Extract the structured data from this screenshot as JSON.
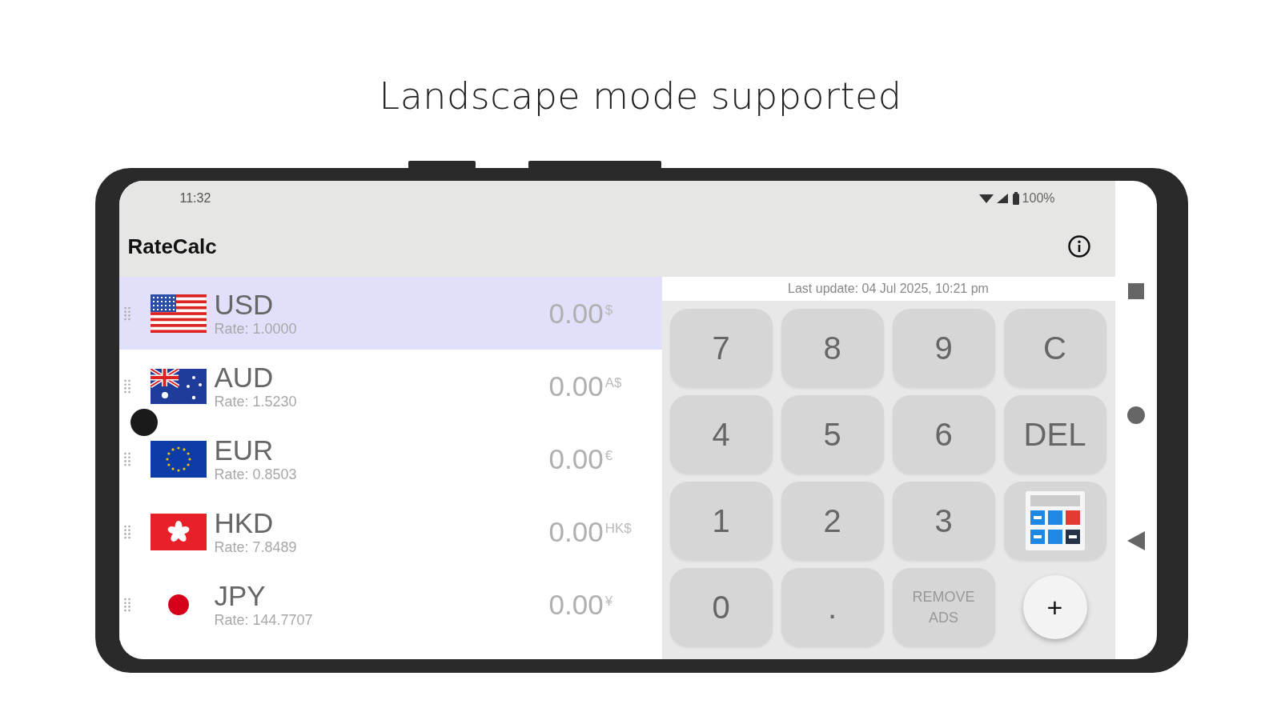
{
  "headline": "Landscape mode supported",
  "status_bar": {
    "time": "11:32",
    "battery": "100%"
  },
  "app_bar": {
    "title": "RateCalc"
  },
  "currencies": [
    {
      "kind": "us",
      "code": "USD",
      "rate": "Rate: 1.0000",
      "amount": "0.00",
      "symbol": "$",
      "selected": true
    },
    {
      "kind": "au",
      "code": "AUD",
      "rate": "Rate: 1.5230",
      "amount": "0.00",
      "symbol": "A$",
      "selected": false
    },
    {
      "kind": "eu",
      "code": "EUR",
      "rate": "Rate: 0.8503",
      "amount": "0.00",
      "symbol": "€",
      "selected": false
    },
    {
      "kind": "hk",
      "code": "HKD",
      "rate": "Rate: 7.8489",
      "amount": "0.00",
      "symbol": "HK$",
      "selected": false
    },
    {
      "kind": "jp",
      "code": "JPY",
      "rate": "Rate: 144.7707",
      "amount": "0.00",
      "symbol": "¥",
      "selected": false
    }
  ],
  "last_update": "Last update: 04 Jul 2025, 10:21 pm",
  "keys": [
    {
      "kind": "key",
      "label": "7"
    },
    {
      "kind": "key",
      "label": "8"
    },
    {
      "kind": "key",
      "label": "9"
    },
    {
      "kind": "key",
      "label": "C"
    },
    {
      "kind": "key",
      "label": "4"
    },
    {
      "kind": "key",
      "label": "5"
    },
    {
      "kind": "key",
      "label": "6"
    },
    {
      "kind": "key",
      "label": "DEL"
    },
    {
      "kind": "key",
      "label": "1"
    },
    {
      "kind": "key",
      "label": "2"
    },
    {
      "kind": "key",
      "label": "3"
    },
    {
      "kind": "calculator"
    },
    {
      "kind": "key",
      "label": "0"
    },
    {
      "kind": "key",
      "label": "."
    },
    {
      "kind": "small",
      "label": "REMOVE ADS"
    },
    {
      "kind": "fab",
      "label": "+"
    }
  ]
}
